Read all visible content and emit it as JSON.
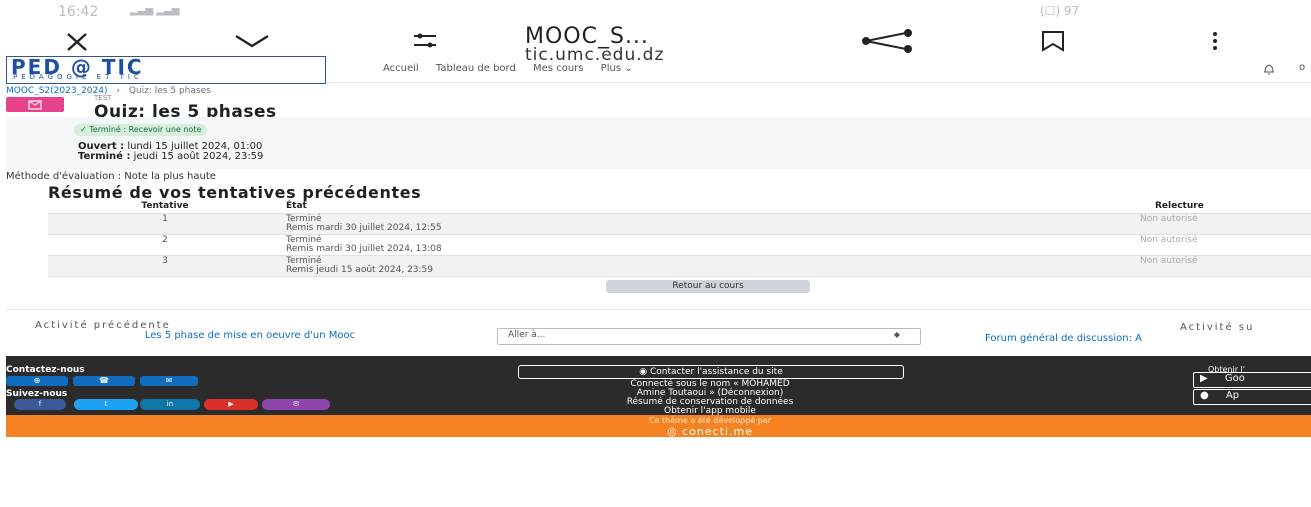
{
  "statusbar": {
    "time": "16:42",
    "icons_text": "(☐) 97"
  },
  "browser": {
    "title": "MOOC_S...",
    "url": "tic.umc.edu.dz"
  },
  "logo": {
    "main": "PED @ TIC",
    "sub": "PEDAGOGIE ET TIC"
  },
  "nav": {
    "items": [
      "Accueil",
      "Tableau de bord",
      "Mes cours",
      "Plus ⌄"
    ]
  },
  "breadcrumb": {
    "course": "MOOC_S2(2023_2024)",
    "separator": "›",
    "current": "Quiz: les 5 phases"
  },
  "header": {
    "section": "TEST",
    "title": "Quiz: les 5 phases"
  },
  "completion": {
    "badge": "✓ Terminé : Recevoir une note"
  },
  "dates": {
    "opened_label": "Ouvert :",
    "opened_value": "lundi 15 juillet 2024, 01:00",
    "closed_label": "Terminé :",
    "closed_value": "jeudi 15 août 2024, 23:59"
  },
  "grading_method": "Méthode d'évaluation : Note la plus haute",
  "summary": {
    "heading": "Résumé de vos tentatives précédentes",
    "columns": [
      "Tentative",
      "État",
      "Relecture"
    ],
    "rows": [
      {
        "attempt": "1",
        "state": "Terminé",
        "submitted": "Remis mardi 30 juillet 2024, 12:55",
        "review": "Non autorisé"
      },
      {
        "attempt": "2",
        "state": "Terminé",
        "submitted": "Remis mardi 30 juillet 2024, 13:08",
        "review": "Non autorisé"
      },
      {
        "attempt": "3",
        "state": "Terminé",
        "submitted": "Remis jeudi 15 août 2024, 23:59",
        "review": "Non autorisé"
      }
    ]
  },
  "back_button": "Retour au cours",
  "activity_nav": {
    "prev_label": "Activité précédente",
    "prev_link": "Les 5 phase de mise en oeuvre d'un Mooc",
    "jump_placeholder": "Aller à...",
    "next_label": "Activité su",
    "next_link": "Forum général de discussion: A"
  },
  "footer": {
    "contact_label": "Contactez-nous",
    "follow_label": "Suivez-nous",
    "social": [
      "f",
      "t",
      "in",
      "▶",
      "✉"
    ],
    "assist_button": "Contacter l'assistance du site",
    "logged_in": "Connecté sous le nom « MOHAMED",
    "logged_in_2": "Amine Toutaoui » (Déconnexion)",
    "data_retention": "Résumé de conservation de données",
    "get_app": "Obtenir l'app mobile",
    "get_app_right": "Obtenir l'",
    "google_play": "Goo",
    "app_store": "Ap",
    "developed_by": "Ce thème a été développé par",
    "brand": "conecti.me"
  },
  "colors": {
    "accent": "#0f6cbf",
    "quiz": "#e8428c",
    "footer": "#2b2b2b",
    "orange": "#f58220"
  }
}
